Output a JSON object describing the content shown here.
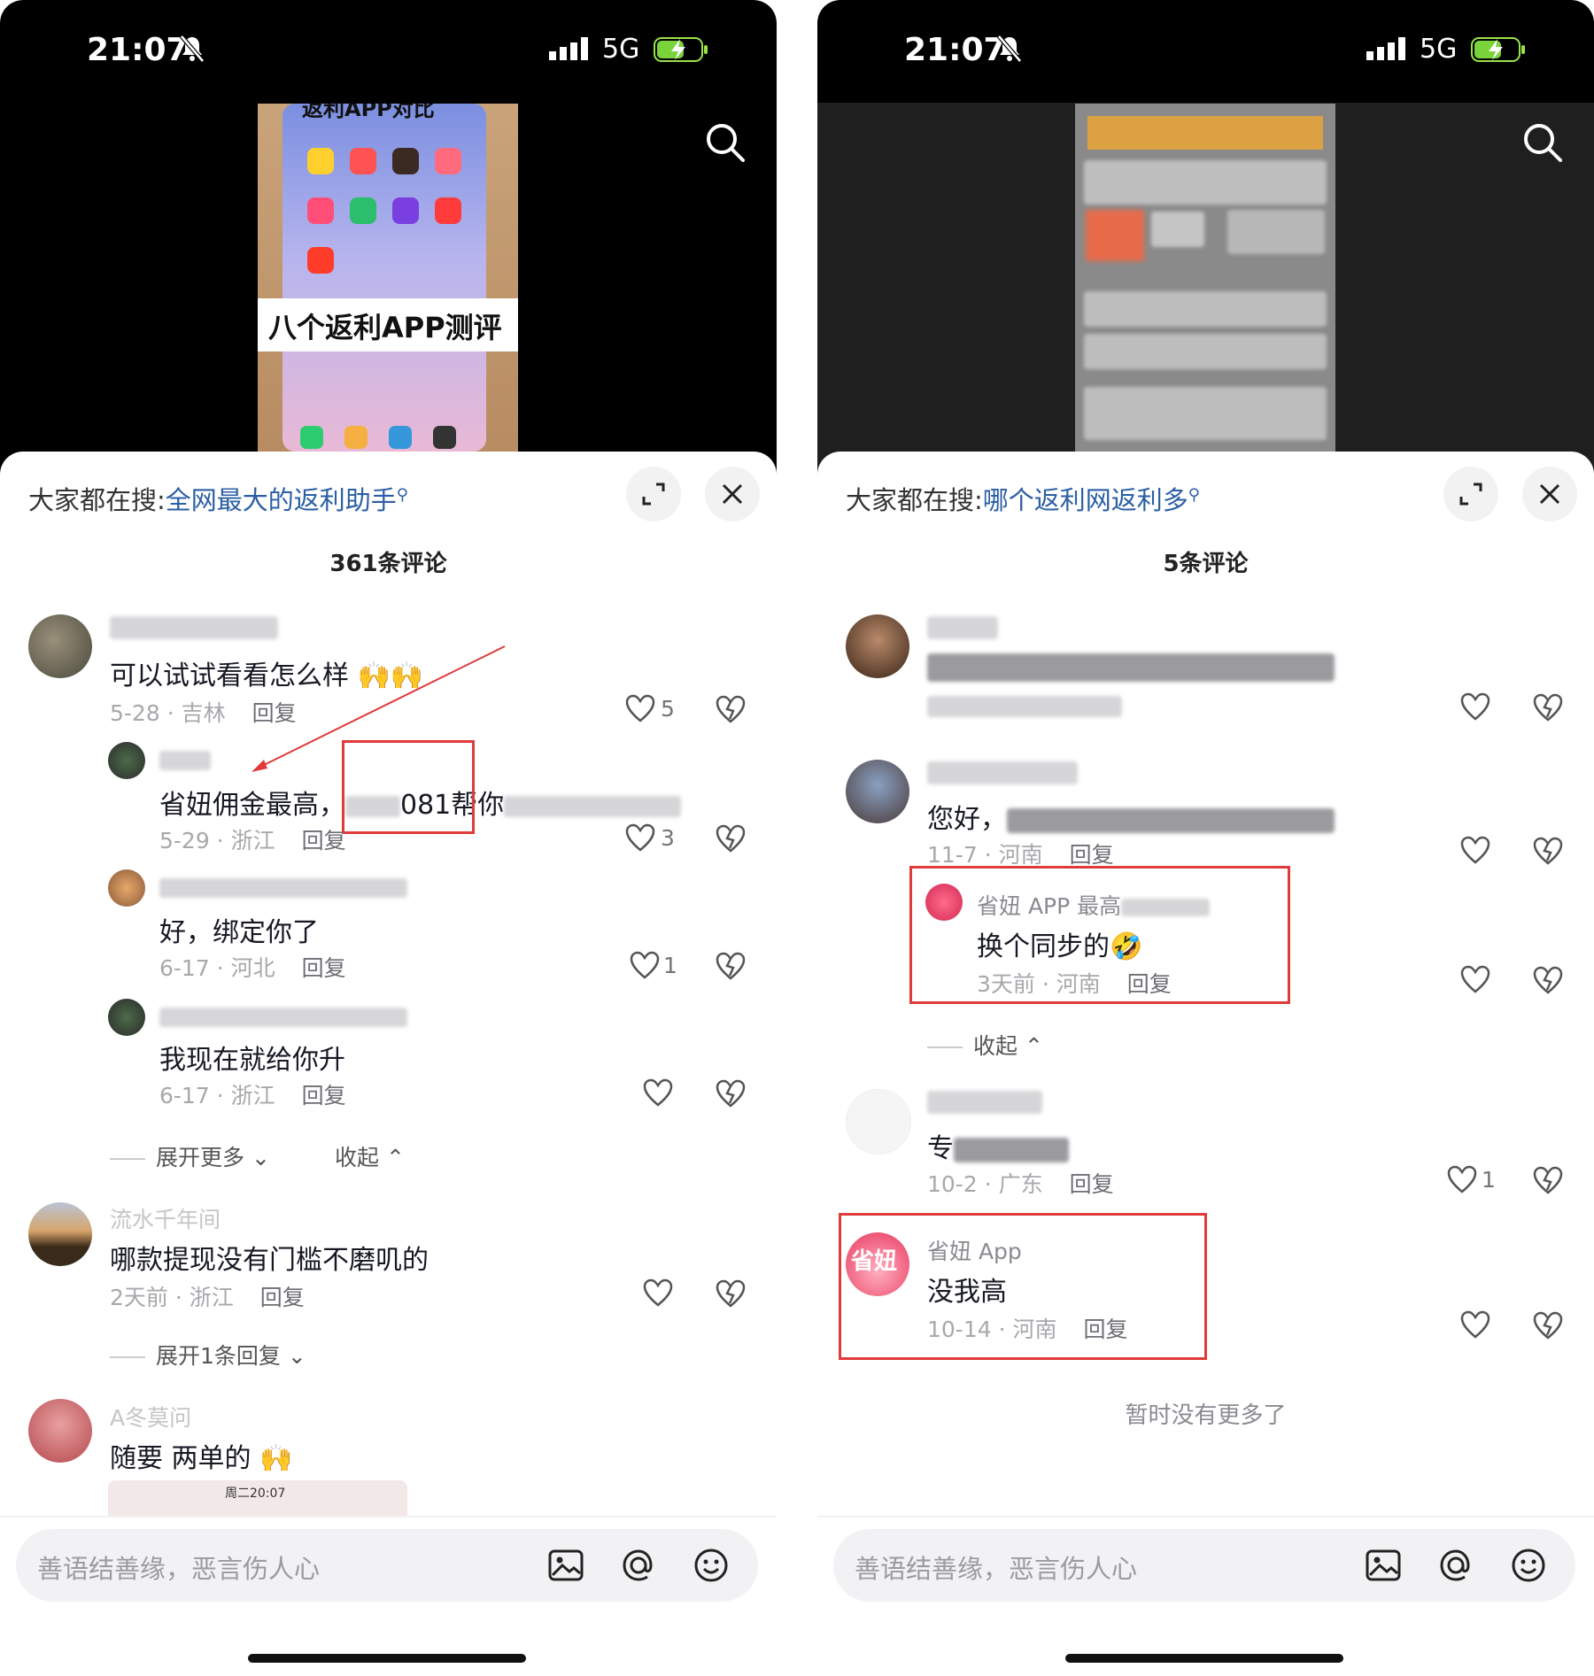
{
  "left": {
    "time": "21:07",
    "network": "5G",
    "video_banner": "八个返利APP测评",
    "video_top_text": "返利APP对比",
    "hot_search": {
      "prefix": "大家都在搜:",
      "keyword": "全网最大的返利助手"
    },
    "comment_count": "361条评论",
    "comments": [
      {
        "text": "可以试试看看怎么样",
        "date": "5-28",
        "region": "吉林",
        "reply": "回复",
        "likes": "5"
      },
      {
        "text": "省妞佣金最高，",
        "text_mid": "081帮你",
        "date": "5-29",
        "region": "浙江",
        "reply": "回复",
        "likes": "3"
      },
      {
        "text": "好，绑定你了",
        "date": "6-17",
        "region": "河北",
        "reply": "回复",
        "likes": "1"
      },
      {
        "text": "我现在就给你升",
        "date": "6-17",
        "region": "浙江",
        "reply": "回复",
        "likes": ""
      },
      {
        "username": "流水千年间",
        "text": "哪款提现没有门槛不磨叽的",
        "date": "2天前",
        "region": "浙江",
        "reply": "回复",
        "likes": ""
      },
      {
        "username": "A冬莫问",
        "text": "随要 两单的",
        "image_caption": "周二20:07"
      }
    ],
    "expand_more": "展开更多",
    "collapse": "收起",
    "expand_one": "展开1条回复",
    "input_placeholder": "善语结善缘，恶言伤人心"
  },
  "right": {
    "time": "21:07",
    "network": "5G",
    "hot_search": {
      "prefix": "大家都在搜:",
      "keyword": "哪个返利网返利多"
    },
    "comment_count": "5条评论",
    "comments": [
      {
        "text": "",
        "likes": ""
      },
      {
        "text": "您好，",
        "date": "11-7",
        "region": "河南",
        "reply": "回复",
        "likes": ""
      },
      {
        "username": "省妞 APP 最高",
        "text": "换个同步的",
        "date": "3天前",
        "region": "河南",
        "reply": "回复",
        "likes": ""
      },
      {
        "text": "专",
        "date": "10-2",
        "region": "广东",
        "reply": "回复",
        "likes": "1"
      },
      {
        "username": "省妞 App",
        "text": "没我高",
        "date": "10-14",
        "region": "河南",
        "reply": "回复",
        "likes": "",
        "avatar_text": "省妞"
      }
    ],
    "collapse": "收起",
    "no_more": "暂时没有更多了",
    "input_placeholder": "善语结善缘，恶言伤人心"
  },
  "colors": {
    "accent_link": "#2a5ea5",
    "highlight_box": "#e03a3a",
    "annotation_arrow": "#e03a3a"
  },
  "icons": [
    "search-icon",
    "expand-icon",
    "close-icon",
    "heart-icon",
    "dislike-icon",
    "image-icon",
    "at-icon",
    "emoji-icon",
    "bell-muted-icon",
    "signal-icon",
    "battery-icon"
  ]
}
